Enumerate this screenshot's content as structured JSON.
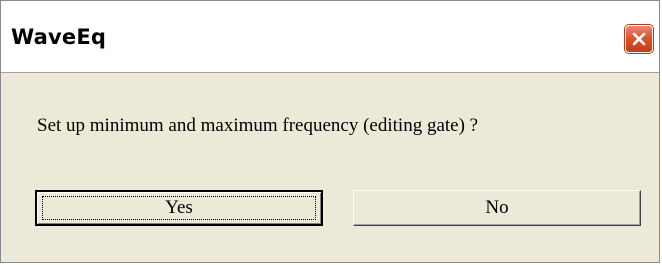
{
  "window": {
    "title": "WaveEq",
    "close_icon": "close-icon"
  },
  "message": "Set up minimum and maximum frequency (editing gate) ?",
  "buttons": {
    "yes_label": "Yes",
    "no_label": "No"
  },
  "colors": {
    "dialog_bg": "#ece9d8",
    "close_button": "#d9572f"
  }
}
